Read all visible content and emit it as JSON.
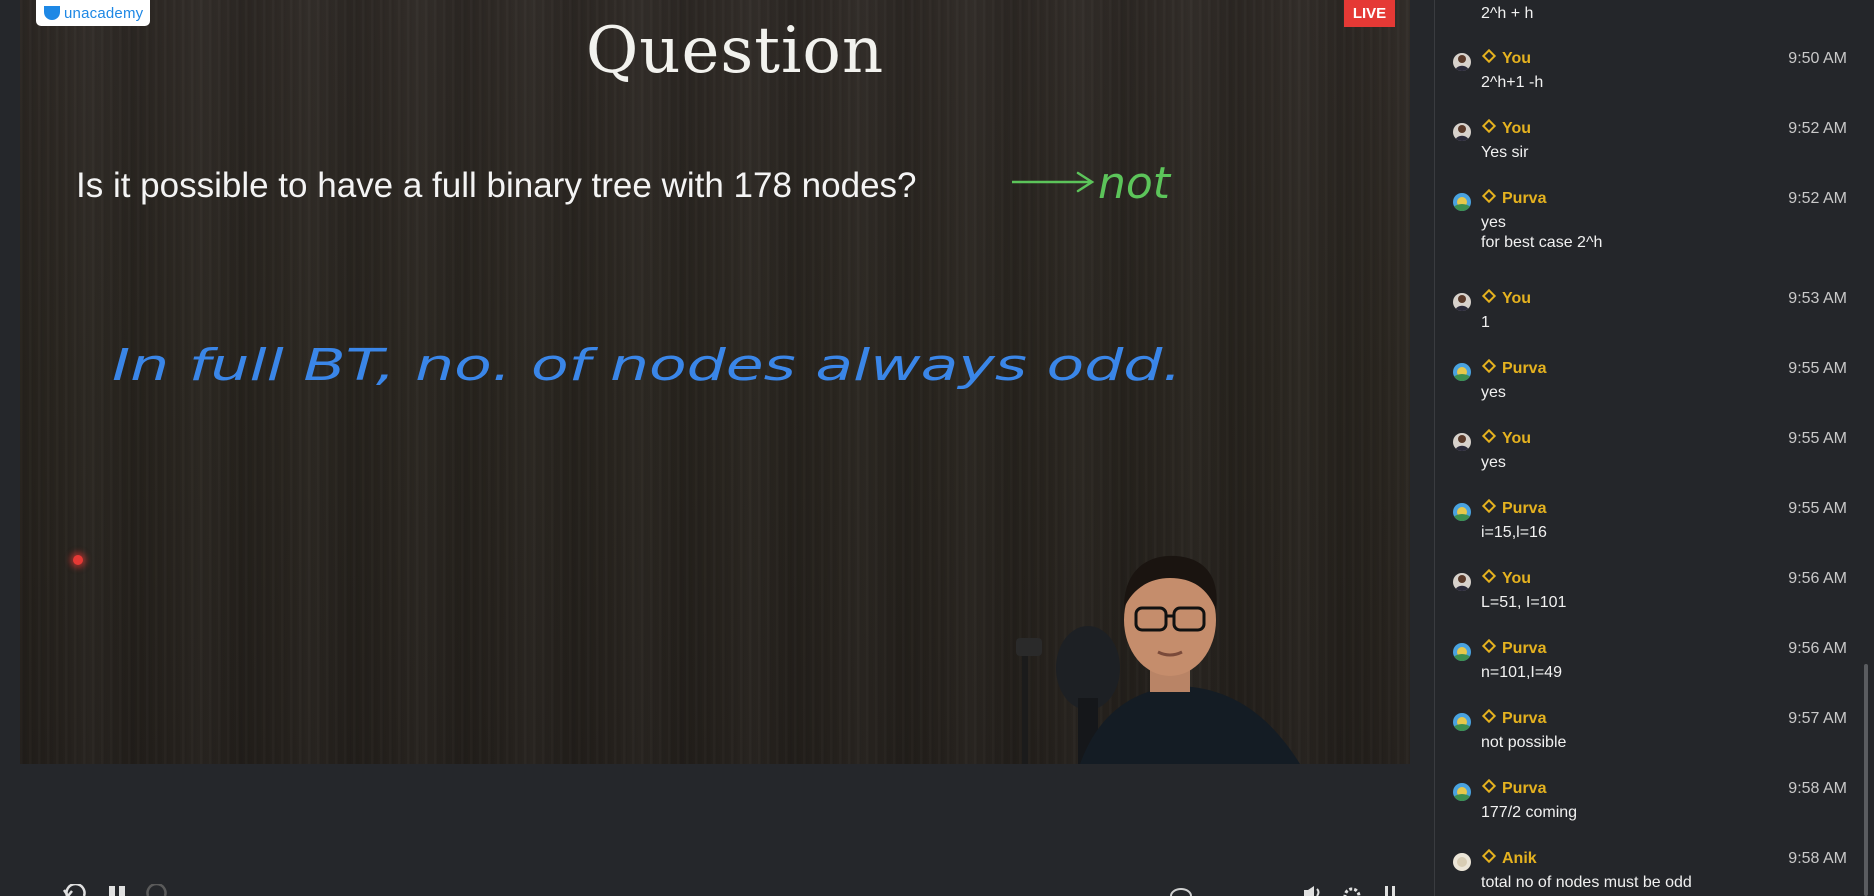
{
  "brand": {
    "logo_text": "unacademy",
    "live_label": "LIVE",
    "brand_color": "#1e88e5",
    "live_color": "#e53935"
  },
  "slide": {
    "title": "Question",
    "question": "Is it possible to have a full binary tree with 178 nodes?",
    "annotation_answer": "not",
    "annotation_note": "In full BT, no. of nodes always odd.",
    "annotation_answer_color": "#5cc45a",
    "annotation_note_color": "#3a86e8"
  },
  "player": {
    "controls": [
      "rewind-icon",
      "pause-icon",
      "forward-icon",
      "volume-icon",
      "settings-icon",
      "fullscreen-icon"
    ]
  },
  "chat": {
    "top_partial_text": "2^h + h",
    "messages": [
      {
        "author": "You",
        "time": "9:50 AM",
        "text": "2^h+1 -h",
        "avatar": "you"
      },
      {
        "author": "You",
        "time": "9:52 AM",
        "text": "Yes sir",
        "avatar": "you"
      },
      {
        "author": "Purva",
        "time": "9:52 AM",
        "text": "yes\nfor best case 2^h",
        "avatar": "purva"
      },
      {
        "author": "You",
        "time": "9:53 AM",
        "text": "1",
        "avatar": "you"
      },
      {
        "author": "Purva",
        "time": "9:55 AM",
        "text": "yes",
        "avatar": "purva"
      },
      {
        "author": "You",
        "time": "9:55 AM",
        "text": "yes",
        "avatar": "you"
      },
      {
        "author": "Purva",
        "time": "9:55 AM",
        "text": "i=15,l=16",
        "avatar": "purva"
      },
      {
        "author": "You",
        "time": "9:56 AM",
        "text": "L=51, I=101",
        "avatar": "you"
      },
      {
        "author": "Purva",
        "time": "9:56 AM",
        "text": "n=101,I=49",
        "avatar": "purva"
      },
      {
        "author": "Purva",
        "time": "9:57 AM",
        "text": "not possible",
        "avatar": "purva"
      },
      {
        "author": "Purva",
        "time": "9:58 AM",
        "text": "177/2 coming",
        "avatar": "purva"
      },
      {
        "author": "Anik",
        "time": "9:58 AM",
        "text": "total no of nodes must be odd",
        "avatar": "anik"
      }
    ]
  }
}
